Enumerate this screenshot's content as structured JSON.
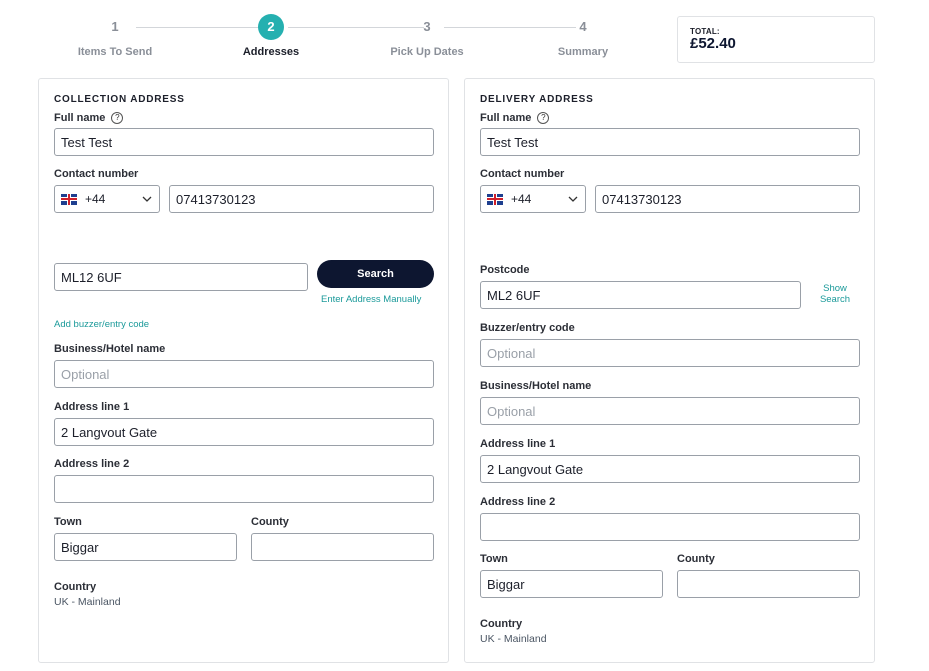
{
  "stepper": {
    "steps": [
      {
        "num": "1",
        "label": "Items To Send"
      },
      {
        "num": "2",
        "label": "Addresses"
      },
      {
        "num": "3",
        "label": "Pick Up Dates"
      },
      {
        "num": "4",
        "label": "Summary"
      }
    ],
    "active_step": 2,
    "accent_color": "#25b0b0"
  },
  "total": {
    "label": "TOTAL:",
    "value": "£52.40"
  },
  "collection": {
    "title": "COLLECTION ADDRESS",
    "full_name_label": "Full name",
    "help_icon": "?",
    "full_name_value": "Test Test",
    "contact_label": "Contact number",
    "country_code": "+44",
    "phone_value": "07413730123",
    "postcode_value": "ML12 6UF",
    "search_label": "Search",
    "enter_manually": "Enter Address Manually",
    "add_buzzer": "Add buzzer/entry code",
    "business_label": "Business/Hotel name",
    "business_placeholder": "Optional",
    "address1_label": "Address line 1",
    "address1_value": "2 Langvout Gate",
    "address2_label": "Address line 2",
    "address2_value": "",
    "town_label": "Town",
    "town_value": "Biggar",
    "county_label": "County",
    "county_value": "",
    "country_label": "Country",
    "country_value": "UK - Mainland"
  },
  "delivery": {
    "title": "DELIVERY ADDRESS",
    "full_name_label": "Full name",
    "help_icon": "?",
    "full_name_value": "Test Test",
    "contact_label": "Contact number",
    "country_code": "+44",
    "phone_value": "07413730123",
    "postcode_label": "Postcode",
    "postcode_value": "ML2 6UF",
    "show_search_line1": "Show",
    "show_search_line2": "Search",
    "buzzer_label": "Buzzer/entry code",
    "buzzer_placeholder": "Optional",
    "business_label": "Business/Hotel name",
    "business_placeholder": "Optional",
    "address1_label": "Address line 1",
    "address1_value": "2 Langvout Gate",
    "address2_label": "Address line 2",
    "address2_value": "",
    "town_label": "Town",
    "town_value": "Biggar",
    "county_label": "County",
    "county_value": "",
    "country_label": "Country",
    "country_value": "UK - Mainland"
  }
}
